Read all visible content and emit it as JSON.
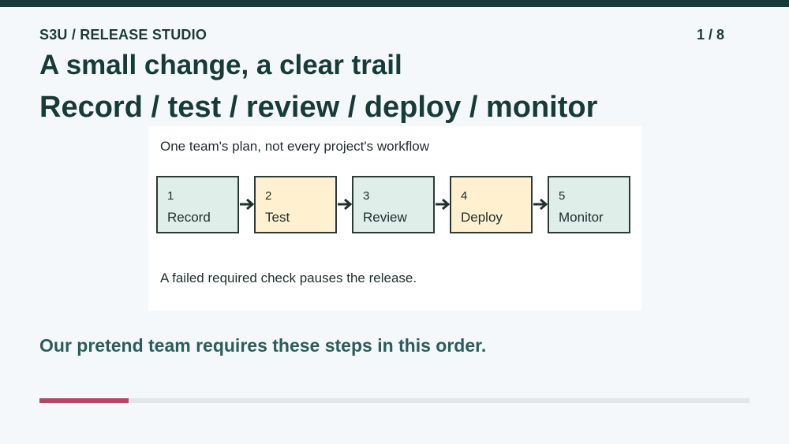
{
  "header": {
    "eyebrow": "S3U / RELEASE STUDIO",
    "page_indicator": "1 / 8"
  },
  "slide": {
    "title": "A small change, a clear trail",
    "subtitle": "Record / test / review / deploy / monitor",
    "card": {
      "caption": "One team's plan, not every project's workflow",
      "steps": [
        {
          "number": "1",
          "label": "Record",
          "color": "#dfeee8"
        },
        {
          "number": "2",
          "label": "Test",
          "color": "#fff0cf"
        },
        {
          "number": "3",
          "label": "Review",
          "color": "#dfeee8"
        },
        {
          "number": "4",
          "label": "Deploy",
          "color": "#fff0cf"
        },
        {
          "number": "5",
          "label": "Monitor",
          "color": "#dfeee8"
        }
      ],
      "footnote": "A failed required check pauses the release."
    },
    "tagline": "Our pretend team requires these steps in this order."
  },
  "progress": {
    "current": 1,
    "total": 8,
    "fraction": 0.125,
    "fill_color": "#b34862",
    "track_color": "#e1e6ea"
  },
  "colors": {
    "top_bar": "#173b3b",
    "heading": "#173b37",
    "tagline": "#2a5d5c",
    "step_border": "#2a3b38"
  },
  "icons": {
    "step_connector": "arrow-right-icon"
  }
}
